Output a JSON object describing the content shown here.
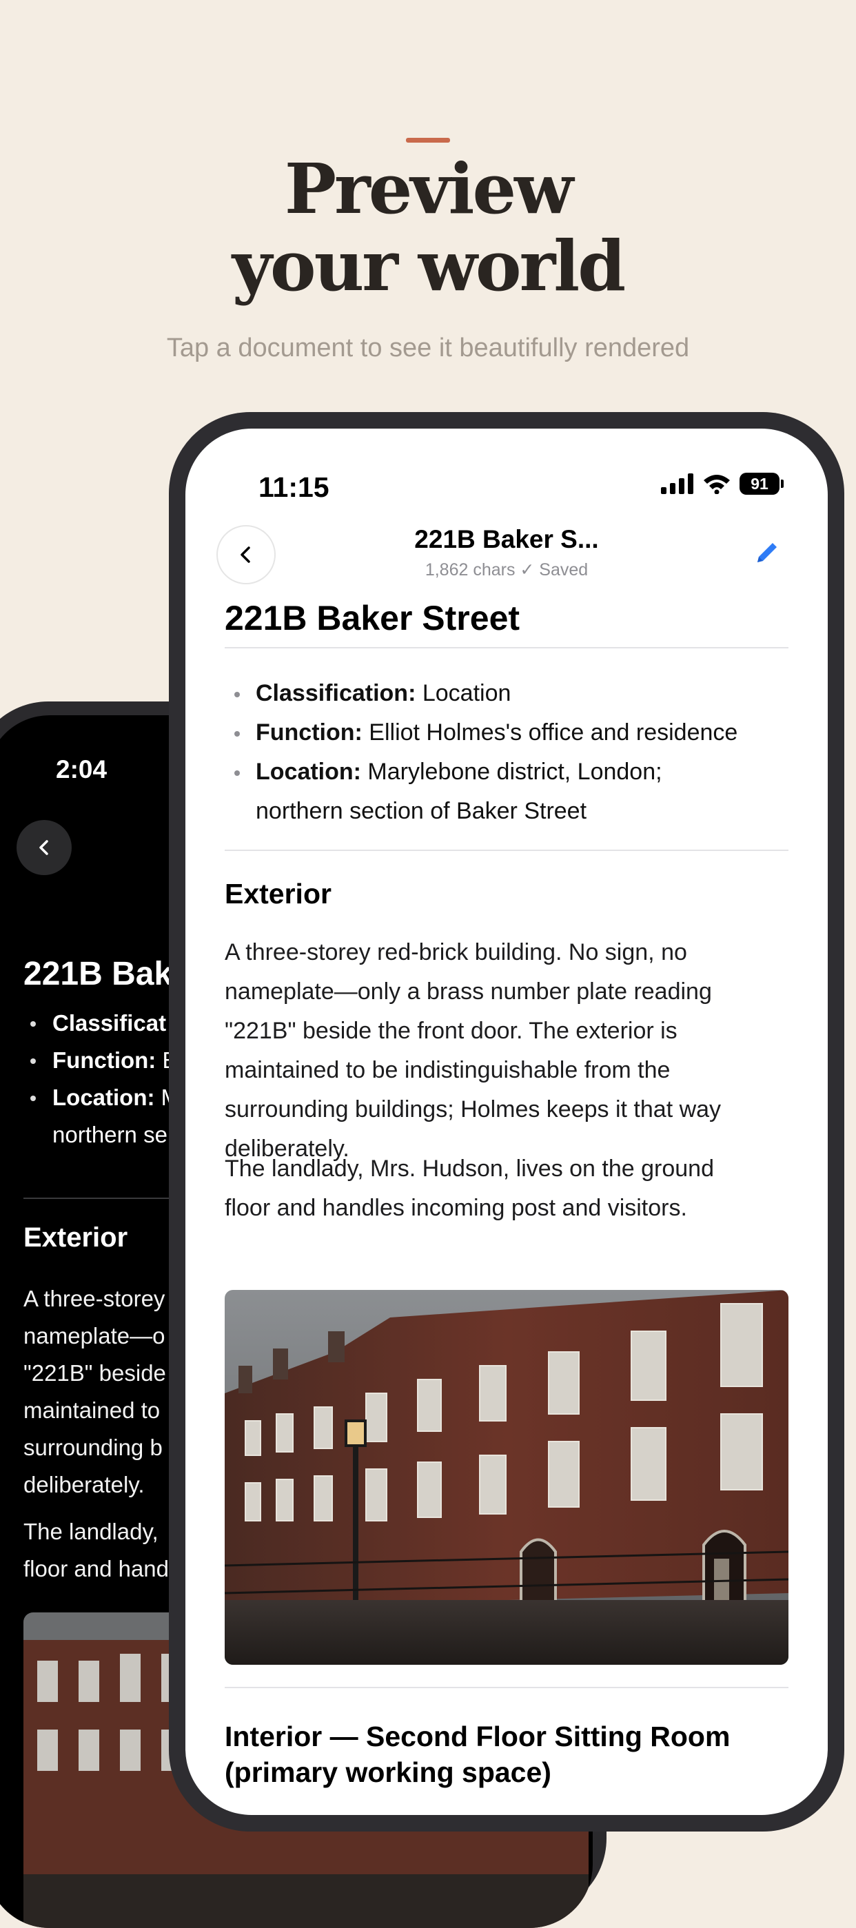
{
  "hero": {
    "title_line1": "Preview",
    "title_line2": "your world",
    "subtitle": "Tap a document to see it beautifully rendered"
  },
  "back_phone": {
    "time": "2:04",
    "title": "221B Bake",
    "bullets": [
      {
        "label": "Classificat",
        "value": ""
      },
      {
        "label": "Function:",
        "value": "E"
      },
      {
        "label": "Location:",
        "value": "M"
      }
    ],
    "bullet_cont": "northern se",
    "section": "Exterior",
    "para1": "A three-storey\nnameplate—o\n\"221B\" beside\nmaintained to\nsurrounding b\ndeliberately.",
    "para2": "The landlady,\nfloor and hand"
  },
  "front_phone": {
    "time": "11:15",
    "battery": "91",
    "nav_title": "221B Baker S...",
    "nav_subtitle": "1,862 chars  ✓ Saved",
    "doc_title": "221B Baker Street",
    "bullets": [
      {
        "label": "Classification:",
        "value": " Location"
      },
      {
        "label": "Function:",
        "value": " Elliot Holmes's office and residence"
      },
      {
        "label": "Location:",
        "value": " Marylebone district, London;"
      }
    ],
    "bullet_cont": "northern section of Baker Street",
    "section_exterior": "Exterior",
    "para1": "A three-storey red-brick building. No sign, no\nnameplate—only a brass number plate reading\n\"221B\" beside the front door. The exterior is\nmaintained to be indistinguishable from the\nsurrounding buildings; Holmes keeps it that way\ndeliberately.",
    "para2": "The landlady, Mrs. Hudson, lives on the ground\nfloor and handles incoming post and visitors.",
    "section_interior": "Interior — Second Floor Sitting Room\n(primary working space)"
  },
  "colors": {
    "background": "#f4ede3",
    "accent": "#c96a4c",
    "edit_blue": "#2f7cf6"
  }
}
